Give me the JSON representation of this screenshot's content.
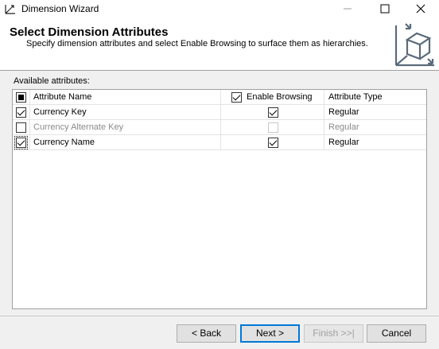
{
  "window": {
    "title": "Dimension Wizard"
  },
  "header": {
    "title": "Select Dimension Attributes",
    "subtitle": "Specify dimension attributes and select Enable Browsing to surface them as hierarchies."
  },
  "attributes_label": "Available attributes:",
  "grid": {
    "columns": {
      "name": "Attribute Name",
      "browsing": "Enable Browsing",
      "type": "Attribute Type"
    },
    "rows": [
      {
        "name": "Currency Key",
        "checked": true,
        "browsing": true,
        "browsing_enabled": true,
        "type": "Regular",
        "disabled": false
      },
      {
        "name": "Currency Alternate Key",
        "checked": false,
        "browsing": false,
        "browsing_enabled": false,
        "type": "Regular",
        "disabled": true
      },
      {
        "name": "Currency Name",
        "checked": true,
        "browsing": true,
        "browsing_enabled": true,
        "type": "Regular",
        "disabled": false
      }
    ]
  },
  "buttons": {
    "back": "< Back",
    "next": "Next >",
    "finish": "Finish >>|",
    "cancel": "Cancel"
  }
}
